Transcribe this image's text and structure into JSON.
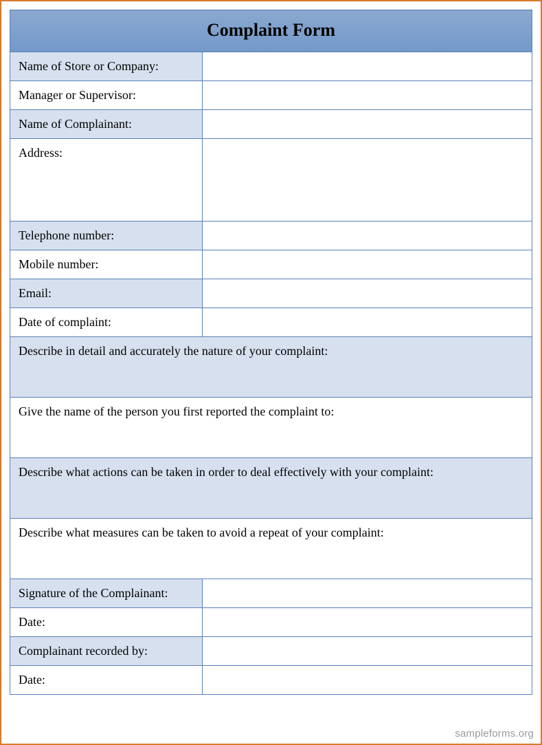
{
  "title": "Complaint Form",
  "fields": {
    "store": "Name of Store or Company:",
    "manager": "Manager or Supervisor:",
    "complainant": "Name of Complainant:",
    "address": "Address:",
    "telephone": "Telephone number:",
    "mobile": "Mobile number:",
    "email": "Email:",
    "date_complaint": "Date of complaint:",
    "describe_nature": "Describe in detail and accurately the nature of your complaint:",
    "first_reported": "Give the name of the person you first reported the complaint to:",
    "actions": "Describe what actions can be taken in order to deal effectively with your complaint:",
    "measures": "Describe what measures can be taken to avoid a repeat of your complaint:",
    "signature": "Signature of the Complainant:",
    "date1": "Date:",
    "recorded_by": "Complainant recorded by:",
    "date2": "Date:"
  },
  "watermark": "sampleforms.org"
}
